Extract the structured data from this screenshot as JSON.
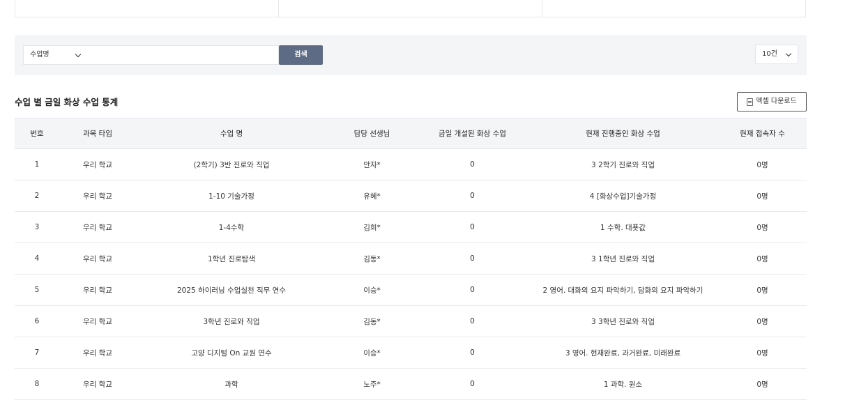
{
  "search": {
    "field_select": "수업명",
    "input_value": "",
    "button_label": "검색",
    "page_size": "10건"
  },
  "section": {
    "title": "수업 별 금일 화상 수업 통계",
    "excel_label": "엑셀 다운로드"
  },
  "table": {
    "headers": [
      "번호",
      "과목 타입",
      "수업 명",
      "담당 선생님",
      "금일 개설된 화상 수업",
      "현재 진행중인 화상 수업",
      "현재 접속자 수"
    ],
    "rows": [
      [
        "1",
        "우리 학교",
        "(2학기) 3반 진로와 직업",
        "안자*",
        "0",
        "3 2학기 진로와 직업",
        "0명"
      ],
      [
        "2",
        "우리 학교",
        "1-10 기술가정",
        "유혜*",
        "0",
        "4 [화상수업]기술가정",
        "0명"
      ],
      [
        "3",
        "우리 학교",
        "1-4수학",
        "김희*",
        "0",
        "1 수학. 대푯값",
        "0명"
      ],
      [
        "4",
        "우리 학교",
        "1학년 진로탐색",
        "김동*",
        "0",
        "3 1학년 진로와 직업",
        "0명"
      ],
      [
        "5",
        "우리 학교",
        "2025 하이러닝 수업실천 직무 연수",
        "이승*",
        "0",
        "2 영어. 대화의 요지 파악하기, 담화의 요지 파악하기",
        "0명"
      ],
      [
        "6",
        "우리 학교",
        "3학년 진로와 직업",
        "김동*",
        "0",
        "3 3학년 진로와 직업",
        "0명"
      ],
      [
        "7",
        "우리 학교",
        "고양 디지털 On 교원 연수",
        "이승*",
        "0",
        "3 영어. 현재완료, 과거완료, 미래완료",
        "0명"
      ],
      [
        "8",
        "우리 학교",
        "과학",
        "노주*",
        "0",
        "1 과학. 원소",
        "0명"
      ]
    ]
  }
}
